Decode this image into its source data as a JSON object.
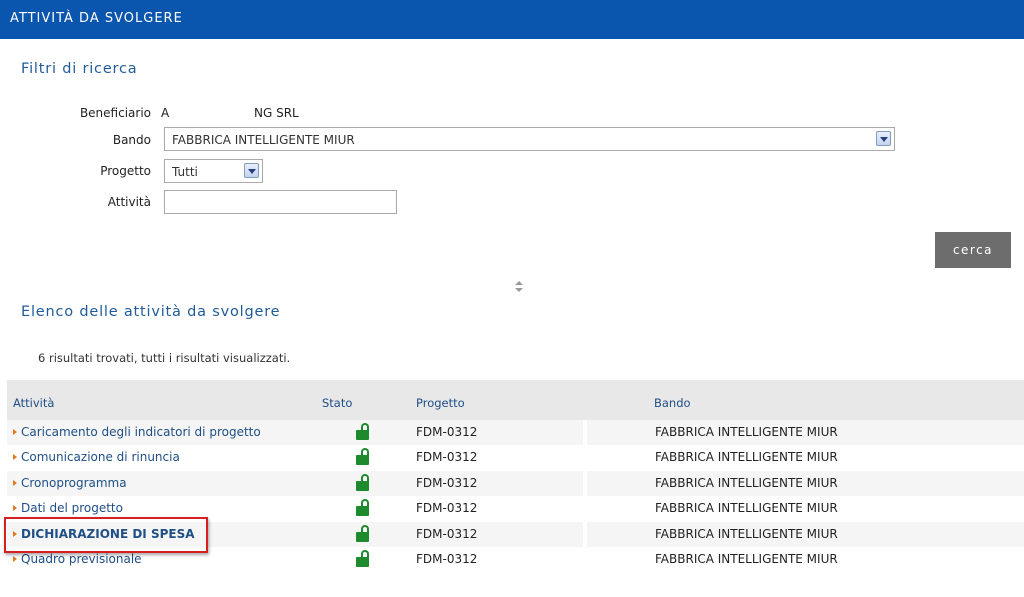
{
  "header": {
    "title": "Attività da svolgere"
  },
  "filters": {
    "section_title": "Filtri di ricerca",
    "beneficiario_label": "Beneficiario",
    "beneficiario_value_start": "A",
    "beneficiario_value_end": "NG SRL",
    "bando_label": "Bando",
    "bando_value": "FABBRICA INTELLIGENTE MIUR",
    "progetto_label": "Progetto",
    "progetto_value": "Tutti",
    "attivita_label": "Attività",
    "attivita_value": "",
    "search_button": "cerca"
  },
  "results": {
    "section_title": "Elenco delle attività da svolgere",
    "count_text": "6 risultati trovati, tutti i risultati visualizzati.",
    "columns": [
      "Attività",
      "Stato",
      "Progetto",
      "Bando"
    ],
    "rows": [
      {
        "attivita": "Caricamento degli indicatori di progetto",
        "stato": "unlocked-icon",
        "progetto": "FDM-0312",
        "bando": "FABBRICA INTELLIGENTE MIUR"
      },
      {
        "attivita": "Comunicazione di rinuncia",
        "stato": "unlocked-icon",
        "progetto": "FDM-0312",
        "bando": "FABBRICA INTELLIGENTE MIUR"
      },
      {
        "attivita": "Cronoprogramma",
        "stato": "unlocked-icon",
        "progetto": "FDM-0312",
        "bando": "FABBRICA INTELLIGENTE MIUR"
      },
      {
        "attivita": "Dati del progetto",
        "stato": "unlocked-icon",
        "progetto": "FDM-0312",
        "bando": "FABBRICA INTELLIGENTE MIUR"
      },
      {
        "attivita": "DICHIARAZIONE DI SPESA",
        "stato": "unlocked-icon",
        "progetto": "FDM-0312",
        "bando": "FABBRICA INTELLIGENTE MIUR"
      },
      {
        "attivita": "Quadro previsionale",
        "stato": "unlocked-icon",
        "progetto": "FDM-0312",
        "bando": "FABBRICA INTELLIGENTE MIUR"
      }
    ]
  },
  "colors": {
    "header_bg": "#0a55ad",
    "link": "#1f4f86",
    "lock": "#1e8a2e",
    "highlight": "#d81f1f",
    "button_bg": "#6d6d6d"
  }
}
